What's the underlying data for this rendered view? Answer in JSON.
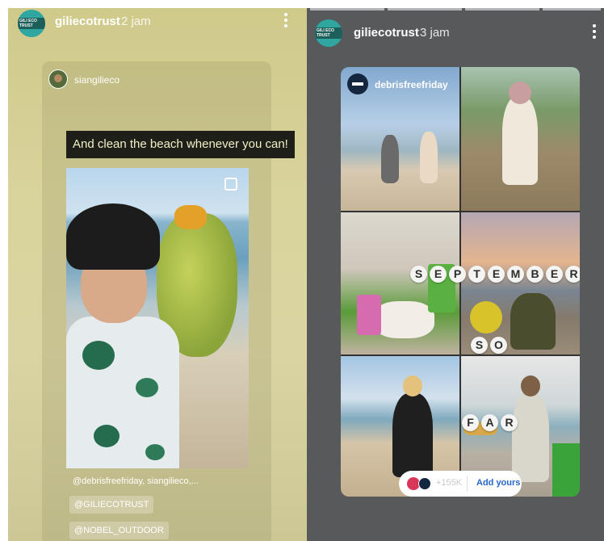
{
  "left_story": {
    "account": "giliecotrust",
    "time": "2 jam",
    "avatar_text": "GILI ECO TRUST",
    "repost": {
      "account": "siangilieco",
      "quote": "And clean the beach whenever you can!",
      "caption": "@debrisfreefriday, siangilieco,...",
      "tags": [
        "@GILIECOTRUST",
        "@NOBEL_OUTDOOR"
      ]
    }
  },
  "right_story": {
    "account": "giliecotrust",
    "time": "3 jam",
    "collage": {
      "account": "debrisfreefriday",
      "words": [
        [
          "S",
          "E",
          "P",
          "T",
          "E",
          "M",
          "B",
          "E",
          "R"
        ],
        [
          "S",
          "O"
        ],
        [
          "F",
          "A",
          "R"
        ]
      ]
    },
    "add_yours": {
      "count": "+155K",
      "label": "Add yours"
    }
  },
  "colors": {
    "left_background": "#d9d39c",
    "quote_background": "#1e1f18",
    "add_yours_text": "#2567c9",
    "avatar_teal": "#2fa6a0"
  },
  "icons": [
    "more-vertical-icon",
    "multi-photo-icon",
    "brand-logo-icon"
  ]
}
